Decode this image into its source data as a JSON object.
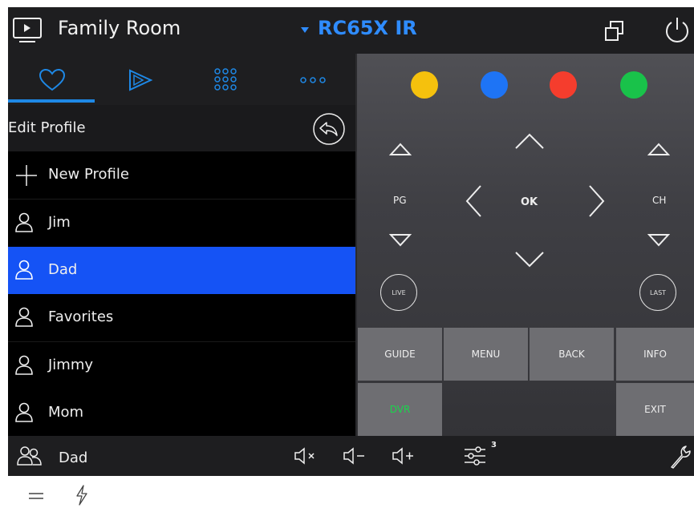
{
  "header": {
    "room_title": "Family Room",
    "device_title": "RC65X IR"
  },
  "tabs": [
    {
      "name": "favorites",
      "icon": "heart-icon",
      "active": true
    },
    {
      "name": "transport",
      "icon": "play-icon",
      "active": false
    },
    {
      "name": "keypad",
      "icon": "keypad-grid-icon",
      "active": false
    },
    {
      "name": "more",
      "icon": "more-dots-icon",
      "active": false
    }
  ],
  "profiles": {
    "header_label": "Edit Profile",
    "new_profile_label": "New Profile",
    "items": [
      {
        "label": "Jim",
        "selected": false
      },
      {
        "label": "Dad",
        "selected": true
      },
      {
        "label": "Favorites",
        "selected": false
      },
      {
        "label": "Jimmy",
        "selected": false
      },
      {
        "label": "Mom",
        "selected": false
      }
    ]
  },
  "remote": {
    "color_buttons": [
      "#f5c10d",
      "#1e74f5",
      "#f53d2d",
      "#19c24a"
    ],
    "pg_label": "PG",
    "ok_label": "OK",
    "ch_label": "CH",
    "live_label": "LIVE",
    "last_label": "LAST",
    "grid": {
      "guide": "GUIDE",
      "menu": "MENU",
      "back": "BACK",
      "info": "INFO",
      "dvr": "DVR",
      "exit": "EXIT"
    }
  },
  "bottom": {
    "profile_name": "Dad",
    "adjust_badge": "3"
  },
  "colors": {
    "accent_blue": "#1553f5",
    "title_blue": "#2f8cff",
    "dvr_green": "#19d64c"
  }
}
